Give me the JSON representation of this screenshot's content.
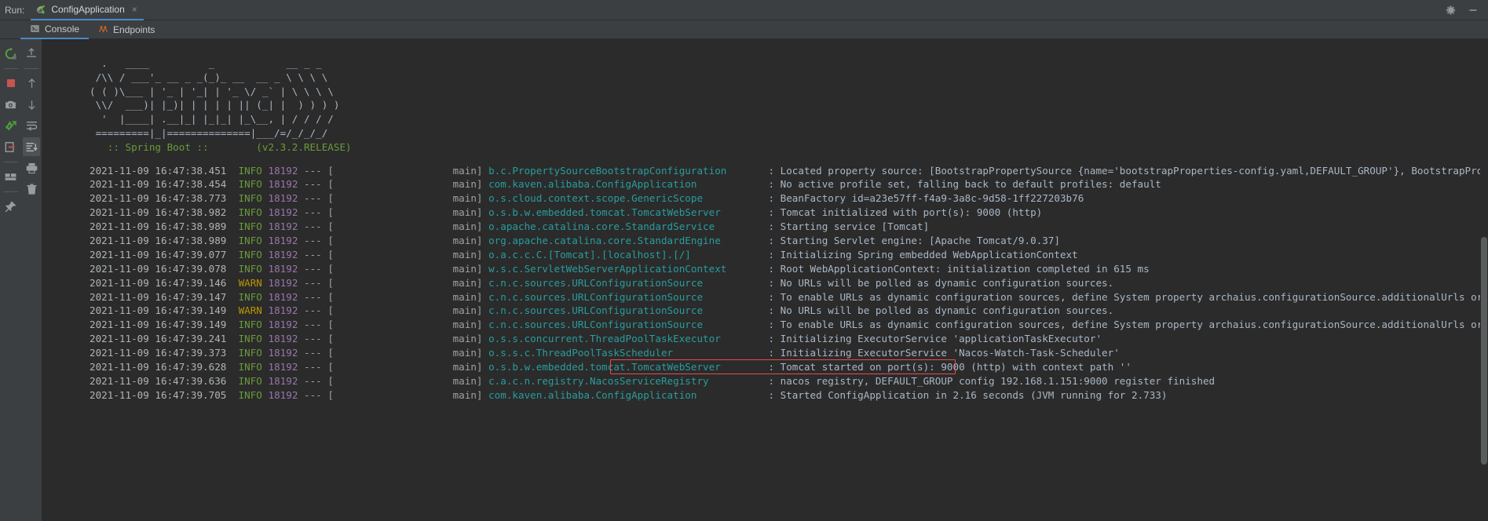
{
  "window": {
    "run_label": "Run:",
    "run_config_name": "ConfigApplication",
    "close_glyph": "×",
    "settings_icon": "gear-icon",
    "minimize_glyph": "—"
  },
  "tabs": [
    {
      "label": "Console",
      "icon": "console-icon",
      "active": true
    },
    {
      "label": "Endpoints",
      "icon": "endpoints-icon",
      "active": false
    }
  ],
  "left_toolbar": {
    "column_one": [
      {
        "name": "rerun-icon",
        "title": "Rerun"
      },
      {
        "name": "stop-icon",
        "title": "Stop"
      },
      {
        "name": "screenshot-icon",
        "title": "Screenshot"
      },
      {
        "name": "attach-debugger-icon",
        "title": "Attach"
      },
      {
        "name": "exit-icon",
        "title": "Exit"
      },
      {
        "name": "layout-icon",
        "title": "Layout"
      },
      {
        "name": "pin-icon",
        "title": "Pin Tab"
      }
    ],
    "column_two": [
      {
        "name": "arrow-up-icon",
        "title": "Up the stack trace"
      },
      {
        "name": "arrow-down-icon",
        "title": "Down the stack trace"
      },
      {
        "name": "soft-wrap-icon",
        "title": "Soft-Wrap"
      },
      {
        "name": "scroll-to-end-icon",
        "title": "Scroll to the end",
        "selected": true
      },
      {
        "name": "print-icon",
        "title": "Print"
      },
      {
        "name": "trash-icon",
        "title": "Clear All"
      }
    ]
  },
  "banner": {
    "art_lines": [
      "  .   ____          _            __ _ _",
      " /\\\\ / ___'_ __ _ _(_)_ __  __ _ \\ \\ \\ \\",
      "( ( )\\___ | '_ | '_| | '_ \\/ _` | \\ \\ \\ \\",
      " \\\\/  ___)| |_)| | | | | || (_| |  ) ) ) )",
      "  '  |____| .__|_| |_|_| |_\\__, | / / / /",
      " =========|_|==============|___/=/_/_/_/"
    ],
    "version_line": "   :: Spring Boot ::        (v2.3.2.RELEASE)"
  },
  "log": {
    "pid": "18192",
    "thread": "main",
    "separator": "--- [",
    "entries": [
      {
        "ts": "2021-11-09 16:47:38.451",
        "level": "INFO",
        "logger": "b.c.PropertySourceBootstrapConfiguration",
        "message": ": Located property source: [BootstrapPropertySource {name='bootstrapProperties-config.yaml,DEFAULT_GROUP'}, BootstrapPropertySo"
      },
      {
        "ts": "2021-11-09 16:47:38.454",
        "level": "INFO",
        "logger": "com.kaven.alibaba.ConfigApplication",
        "message": ": No active profile set, falling back to default profiles: default"
      },
      {
        "ts": "2021-11-09 16:47:38.773",
        "level": "INFO",
        "logger": "o.s.cloud.context.scope.GenericScope",
        "message": ": BeanFactory id=a23e57ff-f4a9-3a8c-9d58-1ff227203b76"
      },
      {
        "ts": "2021-11-09 16:47:38.982",
        "level": "INFO",
        "logger": "o.s.b.w.embedded.tomcat.TomcatWebServer",
        "message": ": Tomcat initialized with port(s): 9000 (http)"
      },
      {
        "ts": "2021-11-09 16:47:38.989",
        "level": "INFO",
        "logger": "o.apache.catalina.core.StandardService",
        "message": ": Starting service [Tomcat]"
      },
      {
        "ts": "2021-11-09 16:47:38.989",
        "level": "INFO",
        "logger": "org.apache.catalina.core.StandardEngine",
        "message": ": Starting Servlet engine: [Apache Tomcat/9.0.37]"
      },
      {
        "ts": "2021-11-09 16:47:39.077",
        "level": "INFO",
        "logger": "o.a.c.c.C.[Tomcat].[localhost].[/]",
        "message": ": Initializing Spring embedded WebApplicationContext"
      },
      {
        "ts": "2021-11-09 16:47:39.078",
        "level": "INFO",
        "logger": "w.s.c.ServletWebServerApplicationContext",
        "message": ": Root WebApplicationContext: initialization completed in 615 ms"
      },
      {
        "ts": "2021-11-09 16:47:39.146",
        "level": "WARN",
        "logger": "c.n.c.sources.URLConfigurationSource",
        "message": ": No URLs will be polled as dynamic configuration sources."
      },
      {
        "ts": "2021-11-09 16:47:39.147",
        "level": "INFO",
        "logger": "c.n.c.sources.URLConfigurationSource",
        "message": ": To enable URLs as dynamic configuration sources, define System property archaius.configurationSource.additionalUrls or make c"
      },
      {
        "ts": "2021-11-09 16:47:39.149",
        "level": "WARN",
        "logger": "c.n.c.sources.URLConfigurationSource",
        "message": ": No URLs will be polled as dynamic configuration sources."
      },
      {
        "ts": "2021-11-09 16:47:39.149",
        "level": "INFO",
        "logger": "c.n.c.sources.URLConfigurationSource",
        "message": ": To enable URLs as dynamic configuration sources, define System property archaius.configurationSource.additionalUrls or make c"
      },
      {
        "ts": "2021-11-09 16:47:39.241",
        "level": "INFO",
        "logger": "o.s.s.concurrent.ThreadPoolTaskExecutor",
        "message": ": Initializing ExecutorService 'applicationTaskExecutor'"
      },
      {
        "ts": "2021-11-09 16:47:39.373",
        "level": "INFO",
        "logger": "o.s.s.c.ThreadPoolTaskScheduler",
        "message": ": Initializing ExecutorService 'Nacos-Watch-Task-Scheduler'"
      },
      {
        "ts": "2021-11-09 16:47:39.628",
        "level": "INFO",
        "logger": "o.s.b.w.embedded.tomcat.TomcatWebServer",
        "message": ": Tomcat started on port(s): 9000 (http) with context path ''",
        "highlighted": true
      },
      {
        "ts": "2021-11-09 16:47:39.636",
        "level": "INFO",
        "logger": "c.a.c.n.registry.NacosServiceRegistry",
        "message": ": nacos registry, DEFAULT_GROUP config 192.168.1.151:9000 register finished"
      },
      {
        "ts": "2021-11-09 16:47:39.705",
        "level": "INFO",
        "logger": "com.kaven.alibaba.ConfigApplication",
        "message": ": Started ConfigApplication in 2.16 seconds (JVM running for 2.733)"
      }
    ]
  },
  "colors": {
    "background": "#3c3f41",
    "console_bg": "#2b2b2b",
    "info": "#6a9a3a",
    "warn": "#b89500",
    "pid": "#9876aa",
    "logger": "#2a9c9c",
    "text": "#a9b7c6",
    "highlight_box": "#e84a4a",
    "tab_underline": "#4a88c7"
  }
}
